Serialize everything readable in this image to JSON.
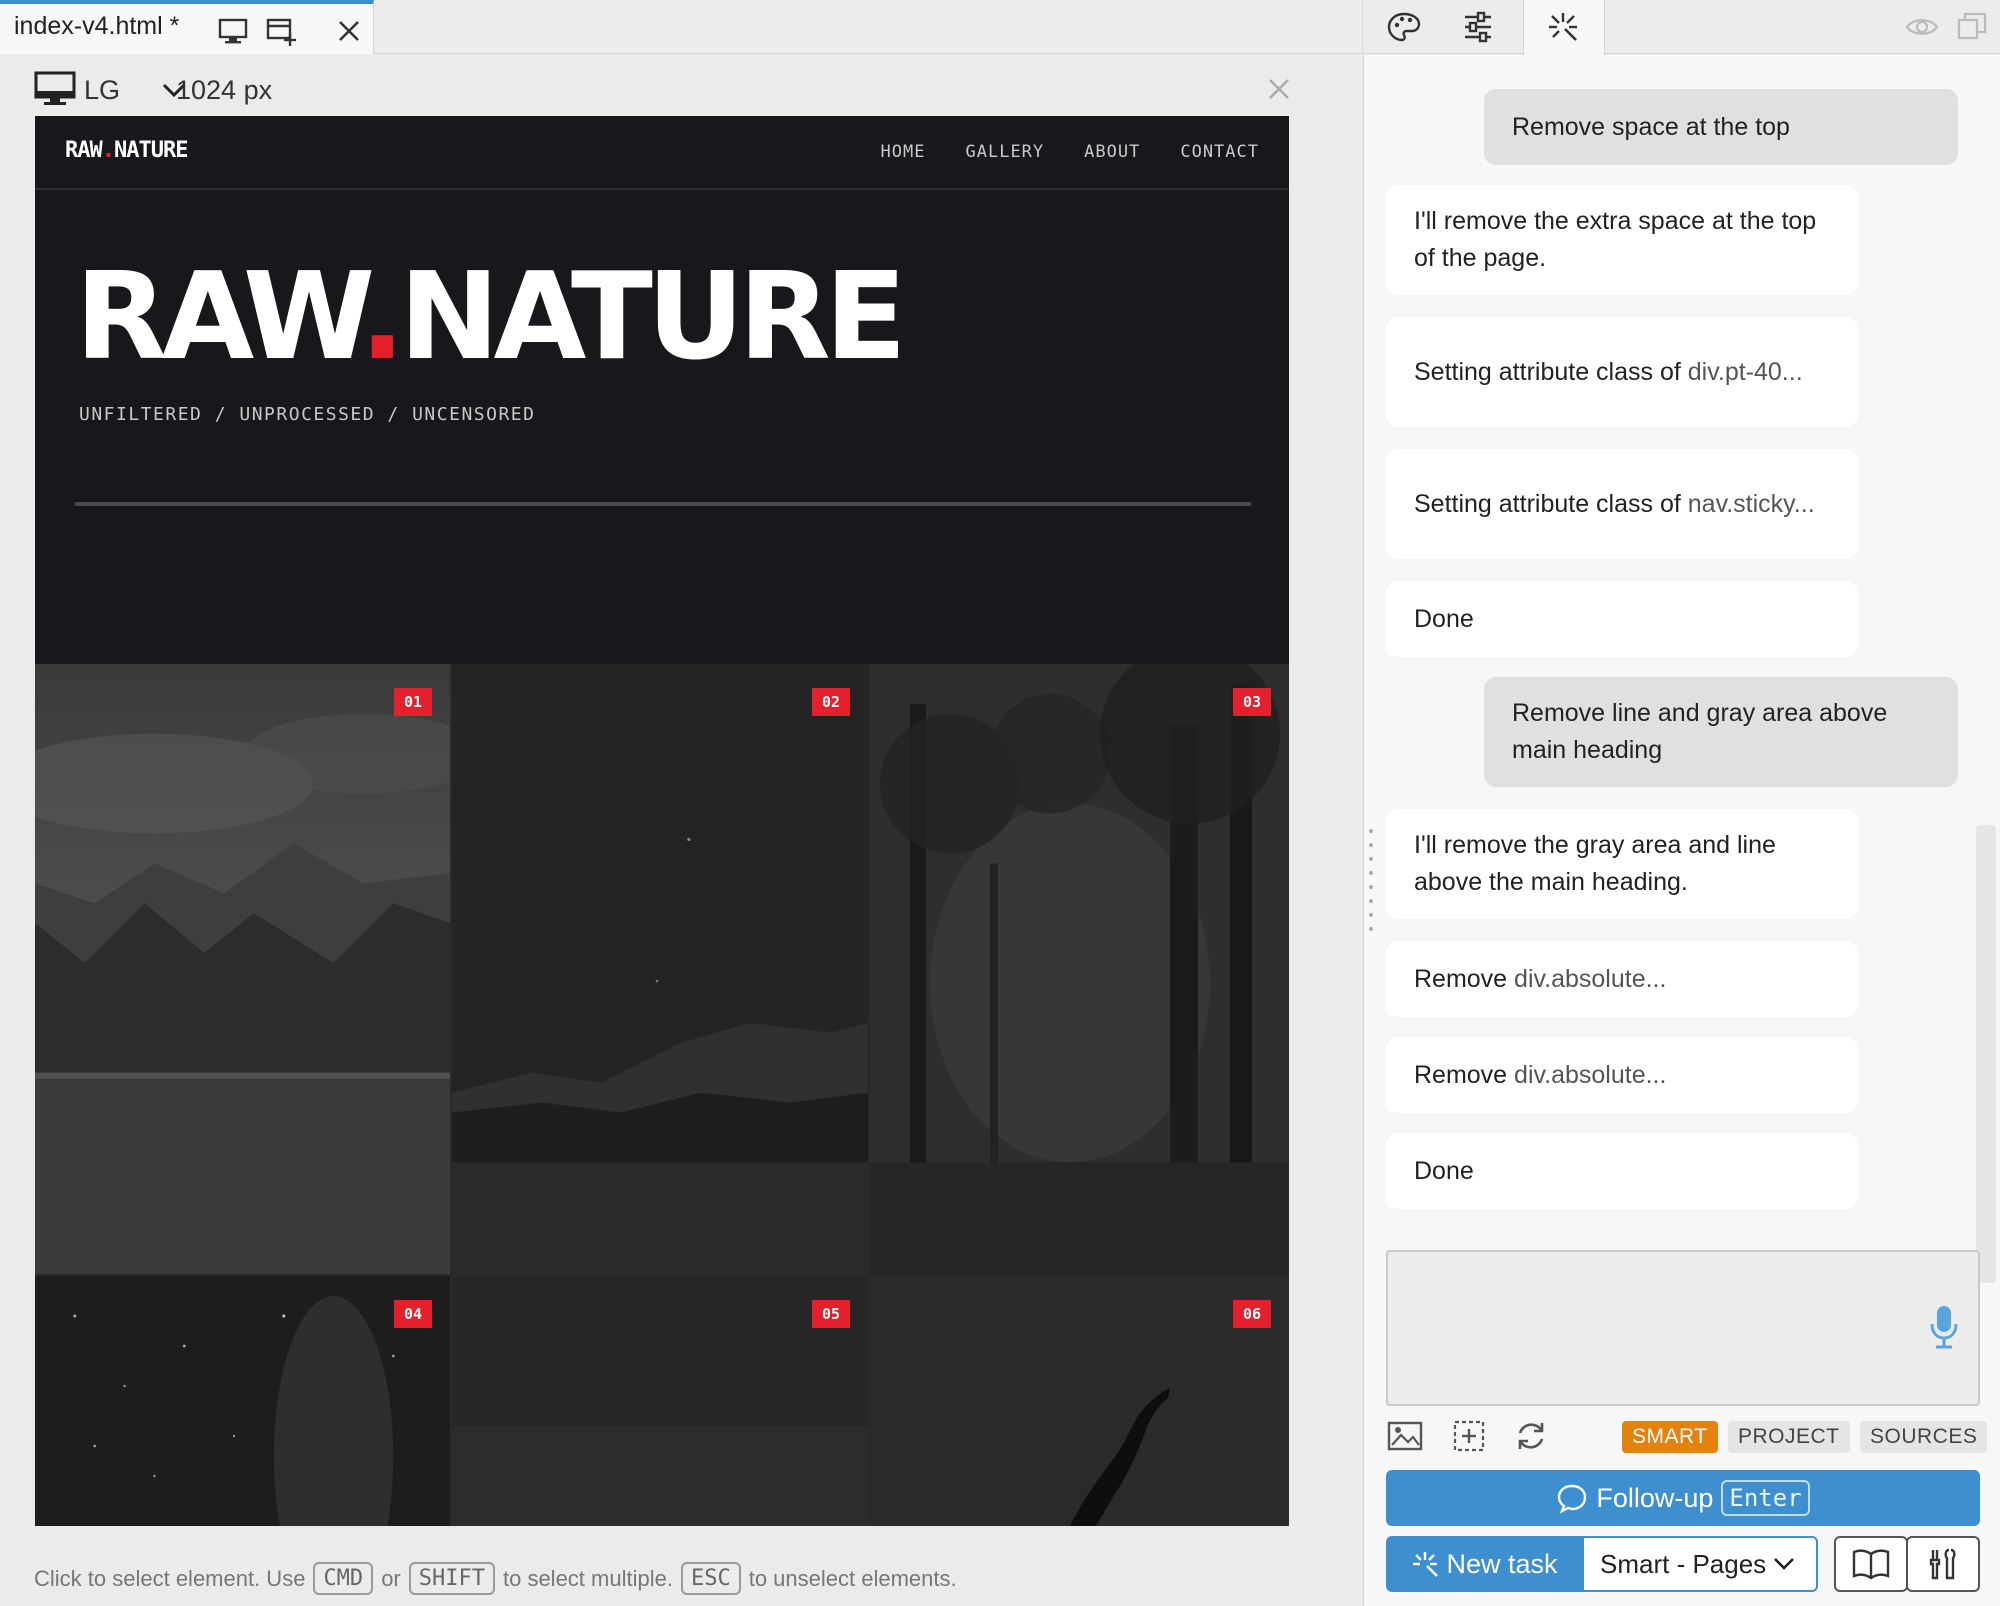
{
  "file_tab": {
    "name": "index-v4.html *"
  },
  "viewport": {
    "size_label": "LG",
    "width_label": "1024 px"
  },
  "site": {
    "logo_left": "RAW",
    "logo_dot": ".",
    "logo_right": "NATURE",
    "nav": [
      "HOME",
      "GALLERY",
      "ABOUT",
      "CONTACT"
    ],
    "hero_title_left": "RAW",
    "hero_title_dot": ".",
    "hero_title_right": "NATURE",
    "hero_subtitle": "UNFILTERED / UNPROCESSED / UNCENSORED",
    "gallery_badges": [
      "01",
      "02",
      "03",
      "04",
      "05",
      "06"
    ]
  },
  "status_bar": {
    "part1": "Click to select element. Use",
    "key1": "CMD",
    "part2": "or",
    "key2": "SHIFT",
    "part3": "to select multiple.",
    "key3": "ESC",
    "part4": "to unselect elements."
  },
  "chat": {
    "messages": [
      {
        "role": "user",
        "text": "Remove space at the top"
      },
      {
        "role": "assistant",
        "text": "I'll remove the extra space at the top of the page."
      },
      {
        "role": "assistant",
        "prefix": "Setting attribute class of ",
        "code": "div.pt-40..."
      },
      {
        "role": "assistant",
        "prefix": "Setting attribute class of ",
        "code": "nav.sticky..."
      },
      {
        "role": "assistant",
        "text": "Done"
      },
      {
        "role": "user",
        "text": "Remove line and gray area above main heading"
      },
      {
        "role": "assistant",
        "text": "I'll remove the gray area and line above the main heading."
      },
      {
        "role": "assistant",
        "prefix": "Remove ",
        "code": "div.absolute..."
      },
      {
        "role": "assistant",
        "prefix": "Remove ",
        "code": "div.absolute..."
      },
      {
        "role": "assistant",
        "text": "Done"
      }
    ],
    "input_value": "",
    "modes": [
      "SMART",
      "PROJECT",
      "SOURCES"
    ],
    "active_mode": "SMART",
    "followup_label": "Follow-up",
    "followup_key": "Enter",
    "new_task_label": "New task",
    "mode_select_value": "Smart - Pages"
  },
  "colors": {
    "accent_blue": "#3d8fd0",
    "smart_orange": "#e3820e",
    "brand_red": "#e5202d"
  }
}
